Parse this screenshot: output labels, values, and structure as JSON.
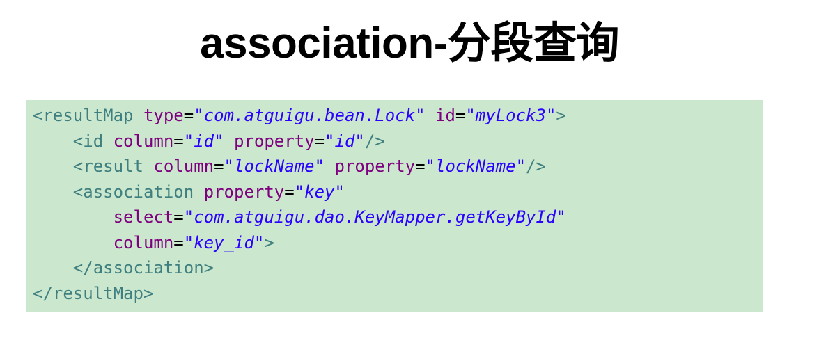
{
  "slide": {
    "title": "association-分段查询"
  },
  "code": {
    "lines": [
      {
        "indent": "",
        "tokens": [
          {
            "type": "tag",
            "text": "<resultMap "
          },
          {
            "type": "attr",
            "text": "type"
          },
          {
            "type": "eq",
            "text": "="
          },
          {
            "type": "val",
            "text": "\"com.atguigu.bean.Lock\""
          },
          {
            "type": "plain",
            "text": " "
          },
          {
            "type": "attr",
            "text": "id"
          },
          {
            "type": "eq",
            "text": "="
          },
          {
            "type": "val",
            "text": "\"myLock3\""
          },
          {
            "type": "tag",
            "text": ">"
          }
        ]
      },
      {
        "indent": "    ",
        "tokens": [
          {
            "type": "tag",
            "text": "<id "
          },
          {
            "type": "attr",
            "text": "column"
          },
          {
            "type": "eq",
            "text": "="
          },
          {
            "type": "val",
            "text": "\"id\""
          },
          {
            "type": "plain",
            "text": " "
          },
          {
            "type": "attr",
            "text": "property"
          },
          {
            "type": "eq",
            "text": "="
          },
          {
            "type": "val",
            "text": "\"id\""
          },
          {
            "type": "tag",
            "text": "/>"
          }
        ]
      },
      {
        "indent": "    ",
        "tokens": [
          {
            "type": "tag",
            "text": "<result "
          },
          {
            "type": "attr",
            "text": "column"
          },
          {
            "type": "eq",
            "text": "="
          },
          {
            "type": "val",
            "text": "\"lockName\""
          },
          {
            "type": "plain",
            "text": " "
          },
          {
            "type": "attr",
            "text": "property"
          },
          {
            "type": "eq",
            "text": "="
          },
          {
            "type": "val",
            "text": "\"lockName\""
          },
          {
            "type": "tag",
            "text": "/>"
          }
        ]
      },
      {
        "indent": "    ",
        "tokens": [
          {
            "type": "tag",
            "text": "<association "
          },
          {
            "type": "attr",
            "text": "property"
          },
          {
            "type": "eq",
            "text": "="
          },
          {
            "type": "val",
            "text": "\"key\""
          }
        ]
      },
      {
        "indent": "        ",
        "tokens": [
          {
            "type": "attr",
            "text": "select"
          },
          {
            "type": "eq",
            "text": "="
          },
          {
            "type": "val",
            "text": "\"com.atguigu.dao.KeyMapper.getKeyById\""
          }
        ]
      },
      {
        "indent": "        ",
        "tokens": [
          {
            "type": "attr",
            "text": "column"
          },
          {
            "type": "eq",
            "text": "="
          },
          {
            "type": "val",
            "text": "\"key_id\""
          },
          {
            "type": "tag",
            "text": ">"
          }
        ]
      },
      {
        "indent": "    ",
        "tokens": [
          {
            "type": "tag",
            "text": "</association>"
          }
        ]
      },
      {
        "indent": "",
        "tokens": [
          {
            "type": "tag",
            "text": "</resultMap>"
          }
        ]
      }
    ]
  },
  "colors": {
    "code_background": "#cbe8cf",
    "tag": "#3f7f7f",
    "attribute": "#7f007f",
    "string_value": "#2a00ff"
  }
}
